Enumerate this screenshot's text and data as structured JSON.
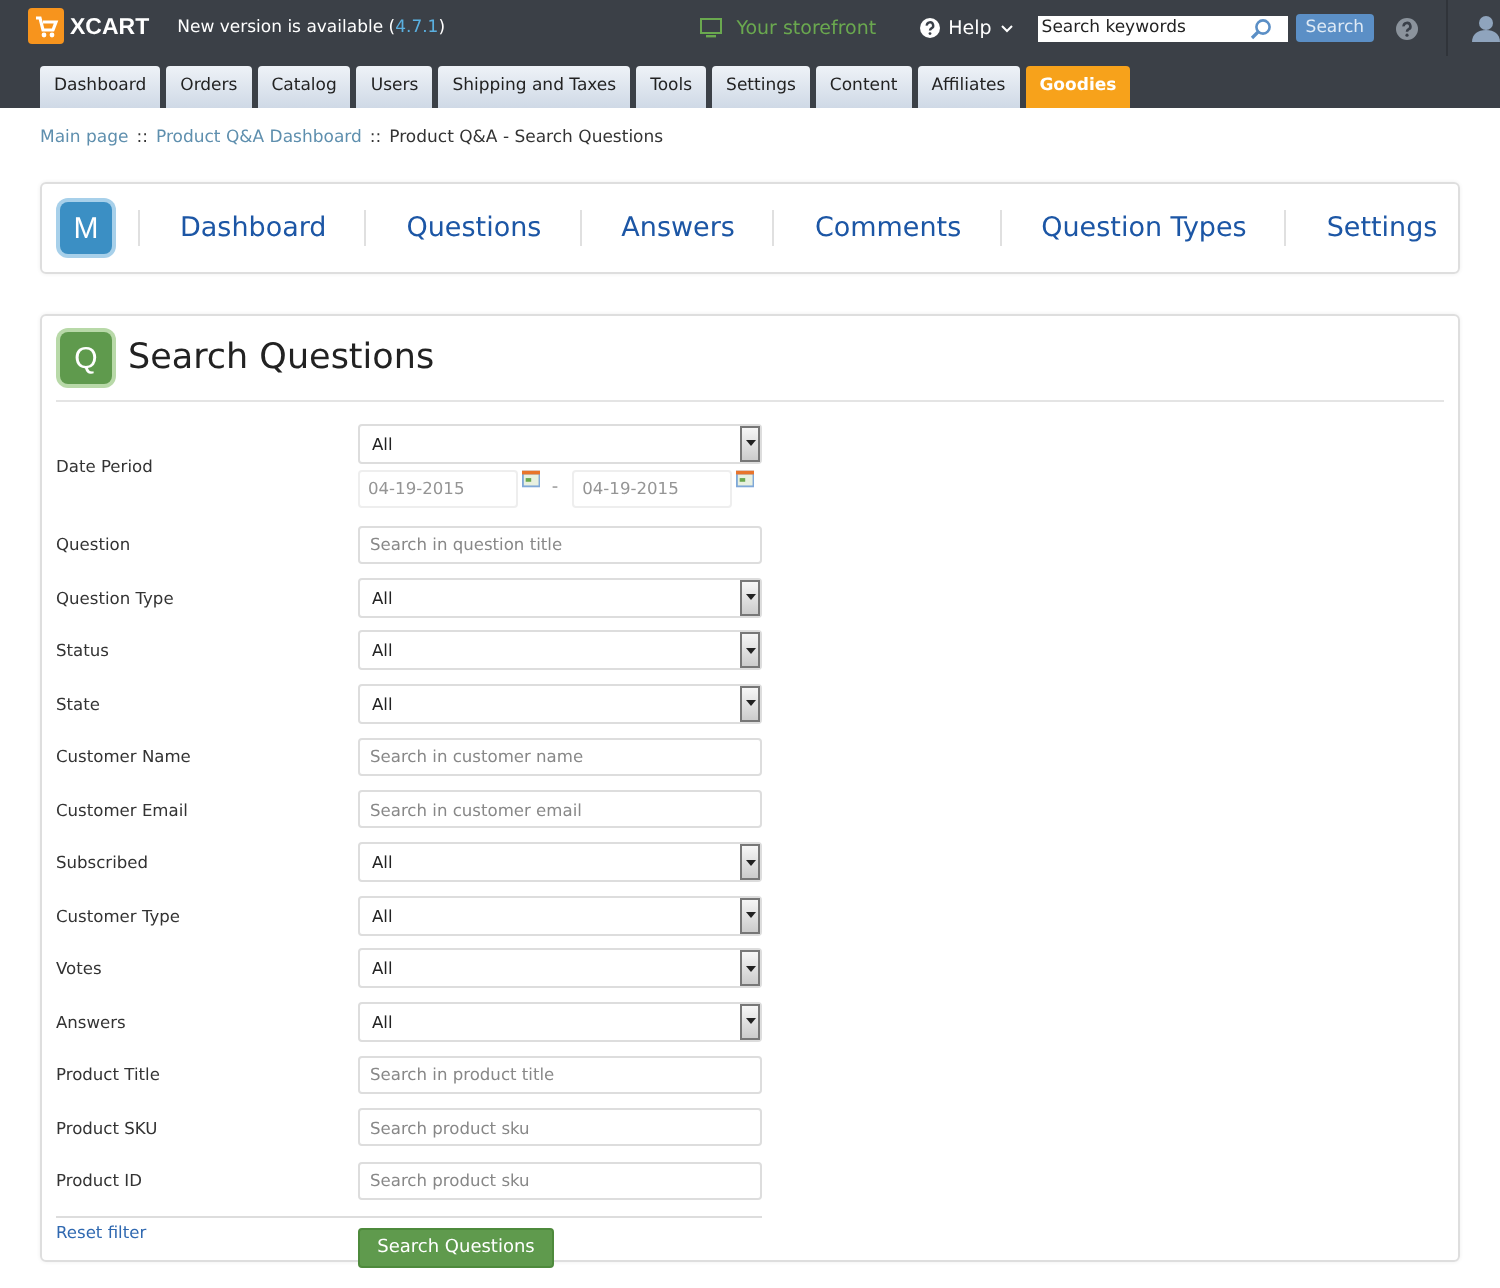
{
  "header": {
    "logo": "XCART",
    "notice": "New version is available (",
    "version": "4.7.1",
    "notice_end": ")",
    "storefront": "Your storefront",
    "help": "Help",
    "search": {
      "placeholder": "Search keywords"
    },
    "search_button": "Search"
  },
  "tabs": [
    {
      "label": "Dashboard",
      "selected": false
    },
    {
      "label": "Orders",
      "selected": false
    },
    {
      "label": "Catalog",
      "selected": false
    },
    {
      "label": "Users",
      "selected": false
    },
    {
      "label": "Shipping and Taxes",
      "selected": false
    },
    {
      "label": "Tools",
      "selected": false
    },
    {
      "label": "Settings",
      "selected": false
    },
    {
      "label": "Content",
      "selected": false
    },
    {
      "label": "Affiliates",
      "selected": false
    },
    {
      "label": "Goodies",
      "selected": true
    }
  ],
  "breadcrumb_separator": "::",
  "breadcrumb": [
    {
      "label": "Main page",
      "link": true
    },
    {
      "label": "Product Q&A Dashboard",
      "link": true
    },
    {
      "label": "Product Q&A - Search Questions",
      "link": false
    }
  ],
  "module_nav": {
    "badge": "M",
    "items": [
      "Dashboard",
      "Questions",
      "Answers",
      "Comments",
      "Question Types",
      "Settings"
    ]
  },
  "search_panel": {
    "badge": "Q",
    "title": "Search Questions",
    "rows": [
      {
        "kind": "date",
        "label": "Date Period",
        "value": "All",
        "from": "04-19-2015",
        "to": "04-19-2015",
        "separator": "-"
      },
      {
        "kind": "text",
        "label": "Question",
        "placeholder": "Search in question title"
      },
      {
        "kind": "select",
        "label": "Question Type",
        "value": "All"
      },
      {
        "kind": "select",
        "label": "Status",
        "value": "All"
      },
      {
        "kind": "select",
        "label": "State",
        "value": "All"
      },
      {
        "kind": "text",
        "label": "Customer Name",
        "placeholder": "Search in customer name"
      },
      {
        "kind": "text",
        "label": "Customer Email",
        "placeholder": "Search in customer email"
      },
      {
        "kind": "select",
        "label": "Subscribed",
        "value": "All"
      },
      {
        "kind": "select",
        "label": "Customer Type",
        "value": "All"
      },
      {
        "kind": "select",
        "label": "Votes",
        "value": "All"
      },
      {
        "kind": "select",
        "label": "Answers",
        "value": "All"
      },
      {
        "kind": "text",
        "label": "Product Title",
        "placeholder": "Search in product title"
      },
      {
        "kind": "text",
        "label": "Product SKU",
        "placeholder": "Search product sku"
      },
      {
        "kind": "text",
        "label": "Product ID",
        "placeholder": "Search product sku"
      }
    ],
    "reset": "Reset filter",
    "submit": "Search Questions"
  }
}
